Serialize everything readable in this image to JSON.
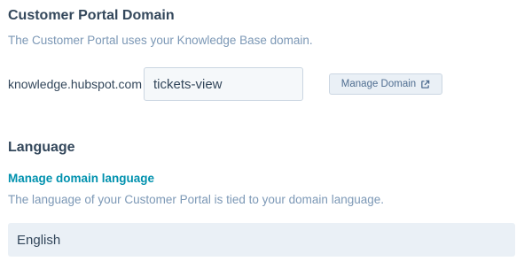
{
  "customer_portal_domain": {
    "title": "Customer Portal Domain",
    "help_text": "The Customer Portal uses your Knowledge Base domain.",
    "domain_prefix": "knowledge.hubspot.com",
    "subdomain_value": "tickets-view",
    "manage_domain_label": "Manage Domain",
    "manage_domain_icon": "external-link-icon"
  },
  "language": {
    "title": "Language",
    "manage_link_label": "Manage domain language",
    "help_text": "The language of your Customer Portal is tied to your domain language.",
    "value": "English"
  },
  "colors": {
    "heading": "#33475b",
    "help_text": "#7c98b6",
    "link": "#0091ae",
    "field_background": "#f5f8fa",
    "disabled_background": "#eaf0f6",
    "border": "#cbd6e2"
  }
}
